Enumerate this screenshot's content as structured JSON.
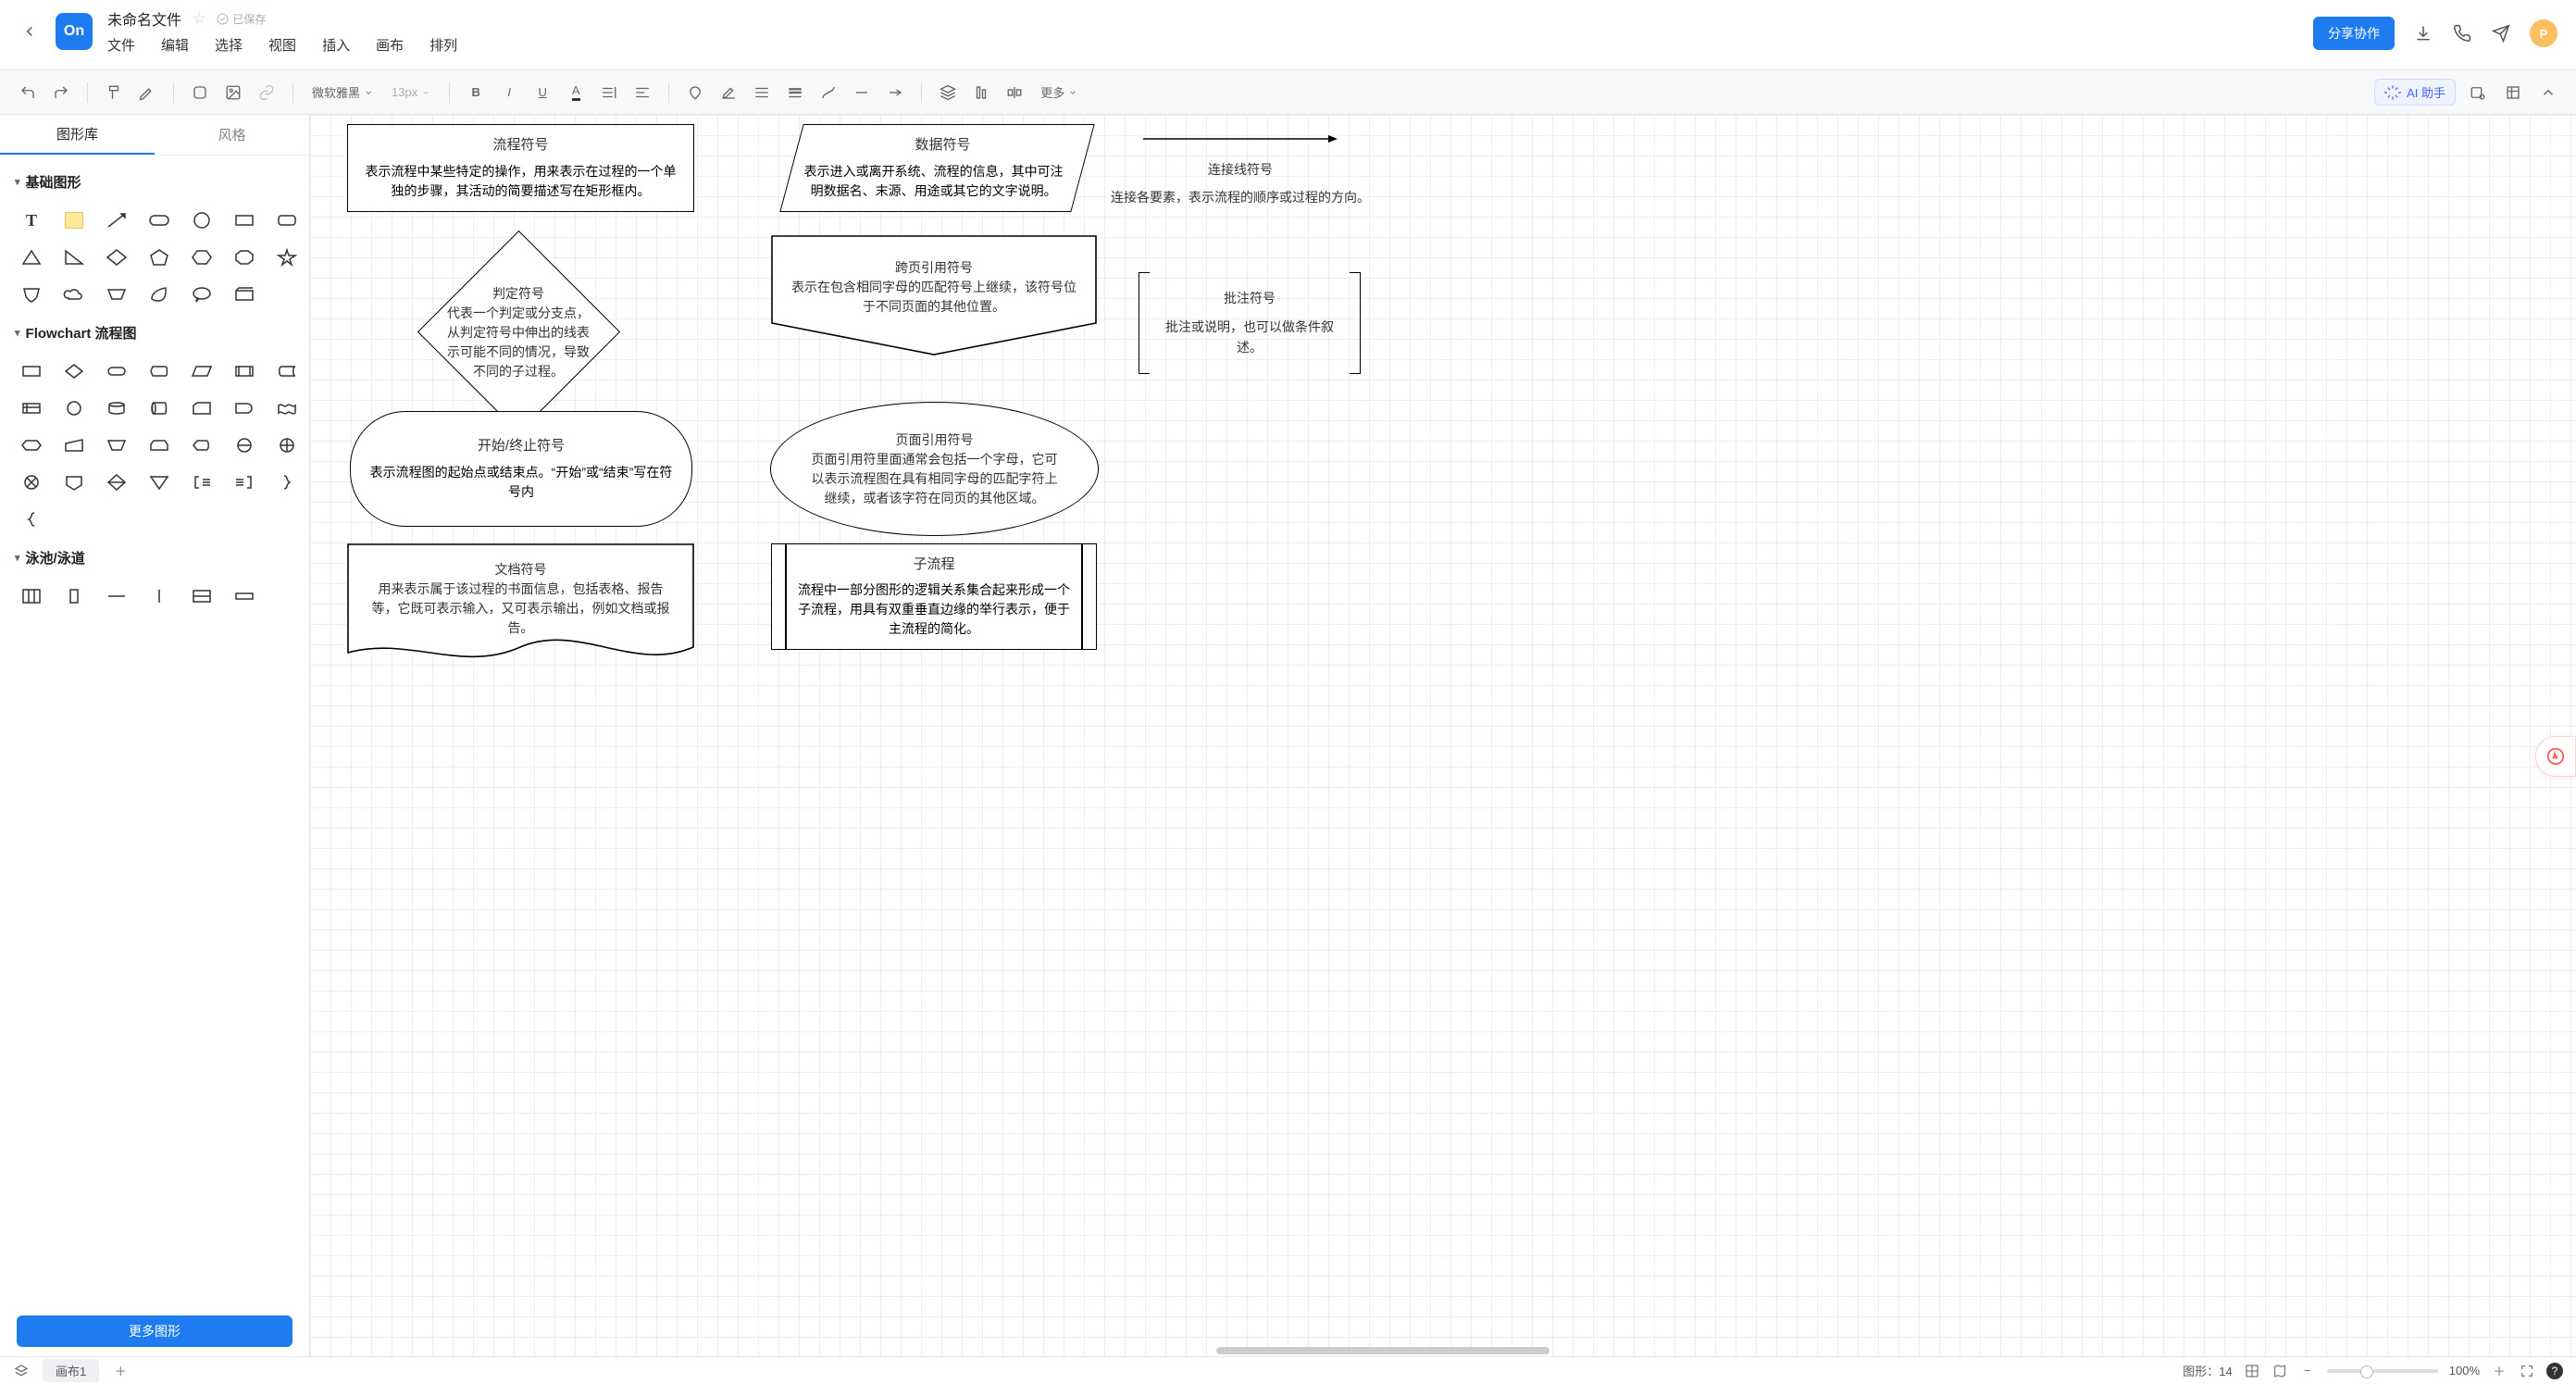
{
  "header": {
    "logo_text": "On",
    "title": "未命名文件",
    "saved_label": "已保存",
    "menus": [
      "文件",
      "编辑",
      "选择",
      "视图",
      "插入",
      "画布",
      "排列"
    ],
    "share_label": "分享协作",
    "avatar_letter": "P"
  },
  "toolbar": {
    "font_family": "微软雅黑",
    "font_size": "13px",
    "more_label": "更多",
    "ai_label": "AI 助手"
  },
  "sidebar": {
    "tabs": {
      "shapes": "图形库",
      "styles": "风格"
    },
    "sections": {
      "basic": "基础图形",
      "flowchart": "Flowchart 流程图",
      "swimlane": "泳池/泳道"
    },
    "more_shapes": "更多图形"
  },
  "canvas": {
    "shapes": {
      "process": {
        "title": "流程符号",
        "desc": "表示流程中某些特定的操作，用来表示在过程的一个单独的步骤，其活动的简要描述写在矩形框内。"
      },
      "data": {
        "title": "数据符号",
        "desc": "表示进入或离开系统、流程的信息，其中可注明数据名、末源、用途或其它的文字说明。"
      },
      "connector": {
        "title": "连接线符号",
        "desc": "连接各要素，表示流程的顺序或过程的方向。"
      },
      "decision": {
        "title": "判定符号",
        "desc": "代表一个判定或分支点，从判定符号中伸出的线表示可能不同的情况，导致不同的子过程。"
      },
      "offpage": {
        "title": "跨页引用符号",
        "desc": "表示在包含相同字母的匹配符号上继续，该符号位于不同页面的其他位置。"
      },
      "annotation": {
        "title": "批注符号",
        "desc": "批注或说明，也可以做条件叙述。"
      },
      "terminator": {
        "title": "开始/终止符号",
        "desc": "表示流程图的起始点或结束点。“开始”或“结束”写在符号内"
      },
      "onpage": {
        "title": "页面引用符号",
        "desc": "页面引用符里面通常会包括一个字母，它可以表示流程图在具有相同字母的匹配字符上继续，或者该字符在同页的其他区域。"
      },
      "document": {
        "title": "文档符号",
        "desc": "用来表示属于该过程的书面信息，包括表格、报告等，它既可表示输入，又可表示输出，例如文档或报告。"
      },
      "subprocess": {
        "title": "子流程",
        "desc": "流程中一部分图形的逻辑关系集合起来形成一个子流程，用具有双重垂直边缘的举行表示，便于主流程的简化。"
      }
    }
  },
  "statusbar": {
    "canvas_tab": "画布1",
    "shape_count_label": "图形：",
    "shape_count": "14",
    "zoom": "100%"
  }
}
